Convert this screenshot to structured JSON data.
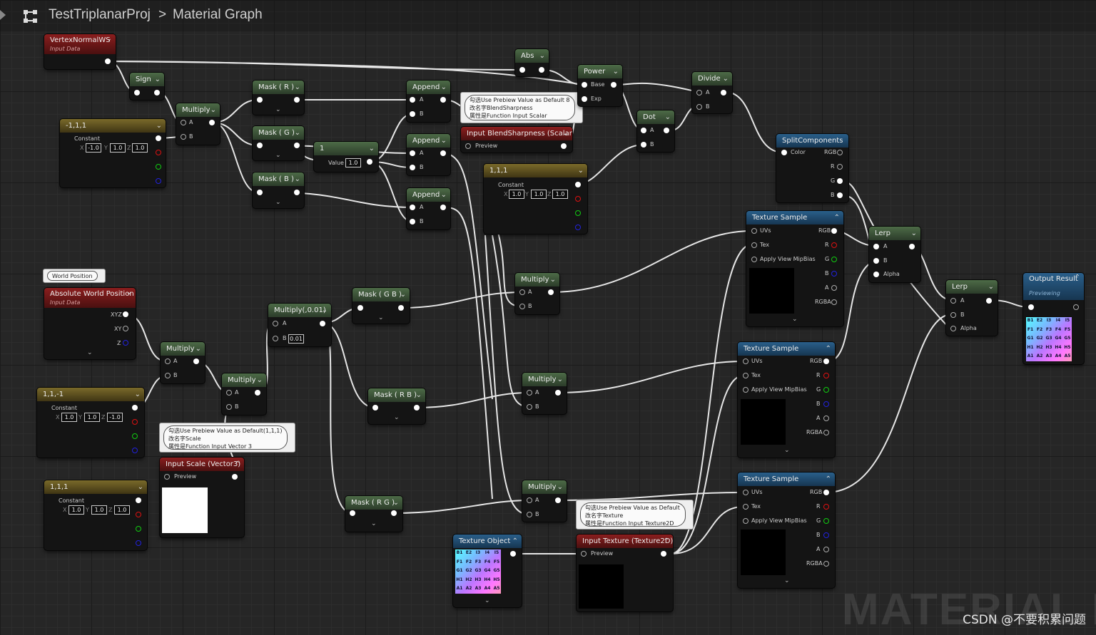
{
  "breadcrumb": {
    "project": "TestTriplanarProj",
    "separator": ">",
    "page": "Material Graph"
  },
  "watermark": "MATERIAL FU",
  "credit": "CSDN @不要积累问题",
  "nodes": {
    "vnws": {
      "title": "VertexNormalWS",
      "subtitle": "Input Data"
    },
    "sign": {
      "title": "Sign"
    },
    "const_neg": {
      "title": "-1,1,1",
      "label": "Constant",
      "x": "-1.0",
      "y": "1.0",
      "z": "1.0"
    },
    "mul1": {
      "title": "Multiply",
      "a": "A",
      "b": "B"
    },
    "maskR": {
      "title": "Mask ( R )"
    },
    "maskG": {
      "title": "Mask ( G )"
    },
    "maskB": {
      "title": "Mask ( B )"
    },
    "one": {
      "title": "1",
      "value_label": "Value",
      "value": "1.0"
    },
    "append1": {
      "title": "Append",
      "a": "A",
      "b": "B"
    },
    "append2": {
      "title": "Append",
      "a": "A",
      "b": "B"
    },
    "append3": {
      "title": "Append",
      "a": "A",
      "b": "B"
    },
    "abs": {
      "title": "Abs"
    },
    "power": {
      "title": "Power",
      "base": "Base",
      "exp": "Exp"
    },
    "divide": {
      "title": "Divide",
      "a": "A",
      "b": "B"
    },
    "dot": {
      "title": "Dot",
      "a": "A",
      "b": "B"
    },
    "blend": {
      "title": "Input BlendSharpness (Scalar)",
      "preview": "Preview"
    },
    "const111": {
      "title": "1,1,1",
      "label": "Constant",
      "x": "1.0",
      "y": "1.0",
      "z": "1.0"
    },
    "split": {
      "title": "SplitComponents",
      "color": "Color",
      "rgb": "RGB",
      "r": "R",
      "g": "G",
      "b": "B"
    },
    "tex1": {
      "title": "Texture Sample",
      "uvs": "UVs",
      "tex": "Tex",
      "mip": "Apply View MipBias",
      "rgb": "RGB",
      "r": "R",
      "g": "G",
      "b": "B",
      "a": "A",
      "rgba": "RGBA"
    },
    "tex2": {
      "title": "Texture Sample",
      "uvs": "UVs",
      "tex": "Tex",
      "mip": "Apply View MipBias",
      "rgb": "RGB",
      "r": "R",
      "g": "G",
      "b": "B",
      "a": "A",
      "rgba": "RGBA"
    },
    "tex3": {
      "title": "Texture Sample",
      "uvs": "UVs",
      "tex": "Tex",
      "mip": "Apply View MipBias",
      "rgb": "RGB",
      "r": "R",
      "g": "G",
      "b": "B",
      "a": "A",
      "rgba": "RGBA"
    },
    "lerp1": {
      "title": "Lerp",
      "a": "A",
      "b": "B",
      "alpha": "Alpha"
    },
    "lerp2": {
      "title": "Lerp",
      "a": "A",
      "b": "B",
      "alpha": "Alpha"
    },
    "output": {
      "title": "Output Result",
      "subtitle": "Previewing"
    },
    "worldpos_cmt": {
      "text": "World Position"
    },
    "awp": {
      "title": "Absolute World Position",
      "subtitle": "Input Data",
      "xyz": "XYZ",
      "xy": "XY",
      "z": "Z"
    },
    "mul2": {
      "title": "Multiply",
      "a": "A",
      "b": "B"
    },
    "mul3": {
      "title": "Multiply",
      "a": "A",
      "b": "B"
    },
    "mul001": {
      "title": "Multiply(,0.01)",
      "a": "A",
      "b": "B",
      "bval": "0.01"
    },
    "maskGB": {
      "title": "Mask ( G B )"
    },
    "maskRB": {
      "title": "Mask ( R B )"
    },
    "maskRG": {
      "title": "Mask ( R G )"
    },
    "mul4": {
      "title": "Multiply",
      "a": "A",
      "b": "B"
    },
    "mul5": {
      "title": "Multiply",
      "a": "A",
      "b": "B"
    },
    "mul6": {
      "title": "Multiply",
      "a": "A",
      "b": "B"
    },
    "const11n": {
      "title": "1,1,-1",
      "label": "Constant",
      "x": "1.0",
      "y": "1.0",
      "z": "-1.0"
    },
    "const111b": {
      "title": "1,1,1",
      "label": "Constant",
      "x": "1.0",
      "y": "1.0",
      "z": "1.0"
    },
    "scale": {
      "title": "Input Scale (Vector3)",
      "preview": "Preview"
    },
    "texobj": {
      "title": "Texture Object"
    },
    "inputtex": {
      "title": "Input Texture (Texture2D)",
      "preview": "Preview"
    }
  },
  "comments": {
    "blend": "勾选Use Prebiew Value as Default 8\n改名字BlendSharpness\n属性是Function Input Scalar",
    "scale": "勾选Use Prebiew Value as Default(1,1,1)\n改名字Scale\n属性是Function Input Vector 3",
    "texture": "勾选Use Prebiew Value as Default\n改名字Texture\n属性是Function Input Texture2D"
  },
  "checker_labels": [
    "B1",
    "E2",
    "I3",
    "I4",
    "I5",
    "F1",
    "F2",
    "F3",
    "F4",
    "F5",
    "G1",
    "G2",
    "G3",
    "G4",
    "G5",
    "H1",
    "H2",
    "H3",
    "H4",
    "H5",
    "A1",
    "A2",
    "A3",
    "A4",
    "A5"
  ],
  "colors": {
    "green_header": "#4d6b47",
    "yellow_header": "#7a6a2a",
    "red_header": "#8b1e1e",
    "blue_header": "#2a5f8a",
    "wire": "#e8e8e8"
  }
}
